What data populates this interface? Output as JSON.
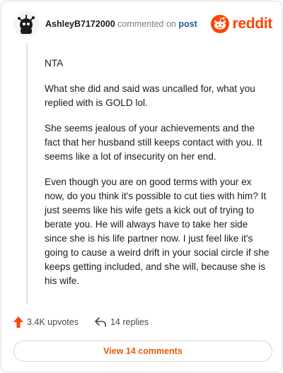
{
  "header": {
    "username": "AshleyB7172000",
    "commented_text": "commented on",
    "post_link": "post",
    "brand_name": "reddit",
    "avatar_icon": "avatar-icon",
    "brand_icon": "reddit-logo-icon"
  },
  "comment": {
    "paragraphs": [
      "NTA",
      "What she did and said was uncalled for, what you replied with is GOLD lol.",
      "She seems jealous of your achievements and the fact that her husband still keeps contact with you. It seems like a lot of insecurity on her end.",
      "Even though you are on good terms with your ex now, do you think it's possible to cut ties with him? It just seems like his wife gets a kick out of trying to berate you. He will always have to take her side since she is his life partner now. I just feel like it's going to cause a weird drift in your social circle if she keeps getting included, and she will, because she is his wife."
    ]
  },
  "actions": {
    "upvotes_label": "3.4K upvotes",
    "replies_label": "14 replies",
    "upvote_icon": "upvote-arrow-icon",
    "reply_icon": "reply-arrow-icon"
  },
  "footer": {
    "view_comments_label": "View 14 comments"
  },
  "colors": {
    "accent": "#ff4500",
    "link": "#1a5ea8",
    "view_button_text": "#e8590c"
  }
}
